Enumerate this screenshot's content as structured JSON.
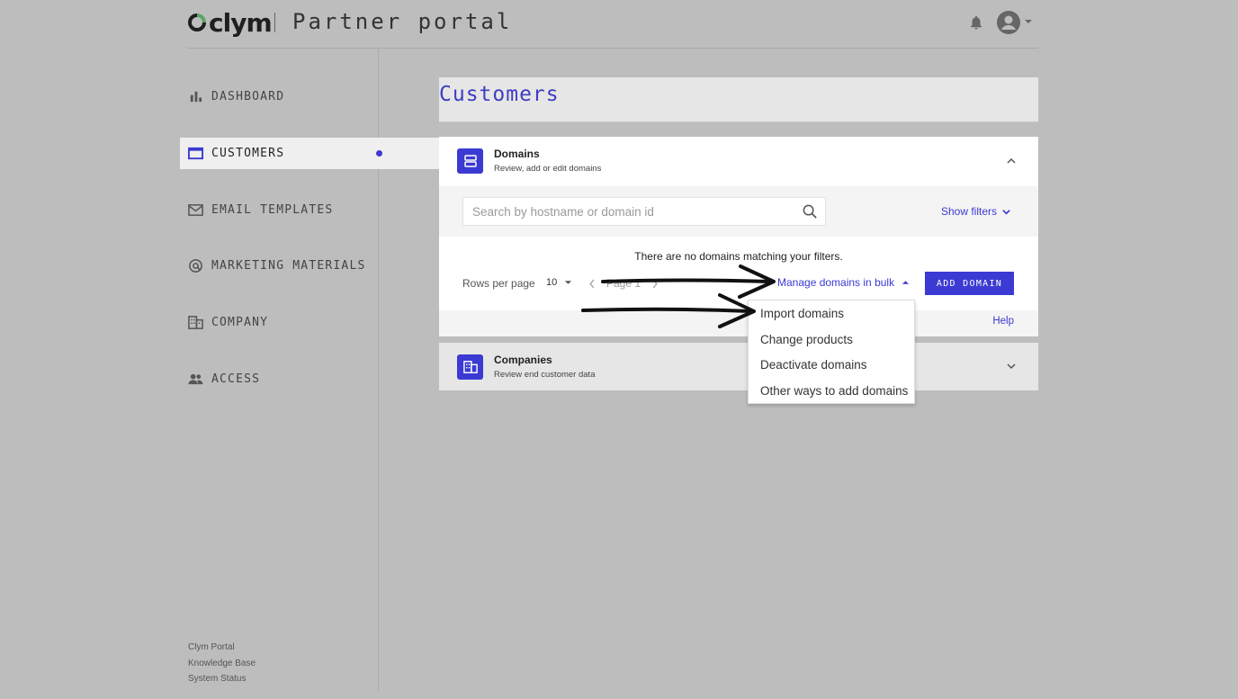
{
  "header": {
    "logo_text": "clym",
    "portal_title": "Partner portal"
  },
  "sidebar": {
    "items": [
      {
        "label": "DASHBOARD",
        "icon": "bar-chart-icon"
      },
      {
        "label": "CUSTOMERS",
        "icon": "browser-window-icon",
        "active": true
      },
      {
        "label": "EMAIL TEMPLATES",
        "icon": "mail-icon"
      },
      {
        "label": "MARKETING MATERIALS",
        "icon": "at-sign-icon"
      },
      {
        "label": "COMPANY",
        "icon": "building-icon"
      },
      {
        "label": "ACCESS",
        "icon": "people-icon"
      }
    ],
    "footer_links": [
      "Clym Portal",
      "Knowledge Base",
      "System Status"
    ]
  },
  "main": {
    "title": "Customers",
    "domains": {
      "title": "Domains",
      "subtitle": "Review, add or edit domains",
      "search_placeholder": "Search by hostname or domain id",
      "show_filters": "Show filters",
      "empty_message": "There are no domains matching your filters.",
      "rows_per_page_label": "Rows per page",
      "rows_per_page_value": "10",
      "page_label": "Page 1",
      "bulk_button": "Manage domains in bulk",
      "add_button": "ADD DOMAIN",
      "help": "Help"
    },
    "companies": {
      "title": "Companies",
      "subtitle": "Review end customer data"
    }
  },
  "bulk_menu": {
    "items": [
      "Import domains",
      "Change products",
      "Deactivate domains",
      "Other ways to add domains"
    ]
  },
  "colors": {
    "accent": "#3b3ad3",
    "overlay_background": "#bdbdbd"
  }
}
